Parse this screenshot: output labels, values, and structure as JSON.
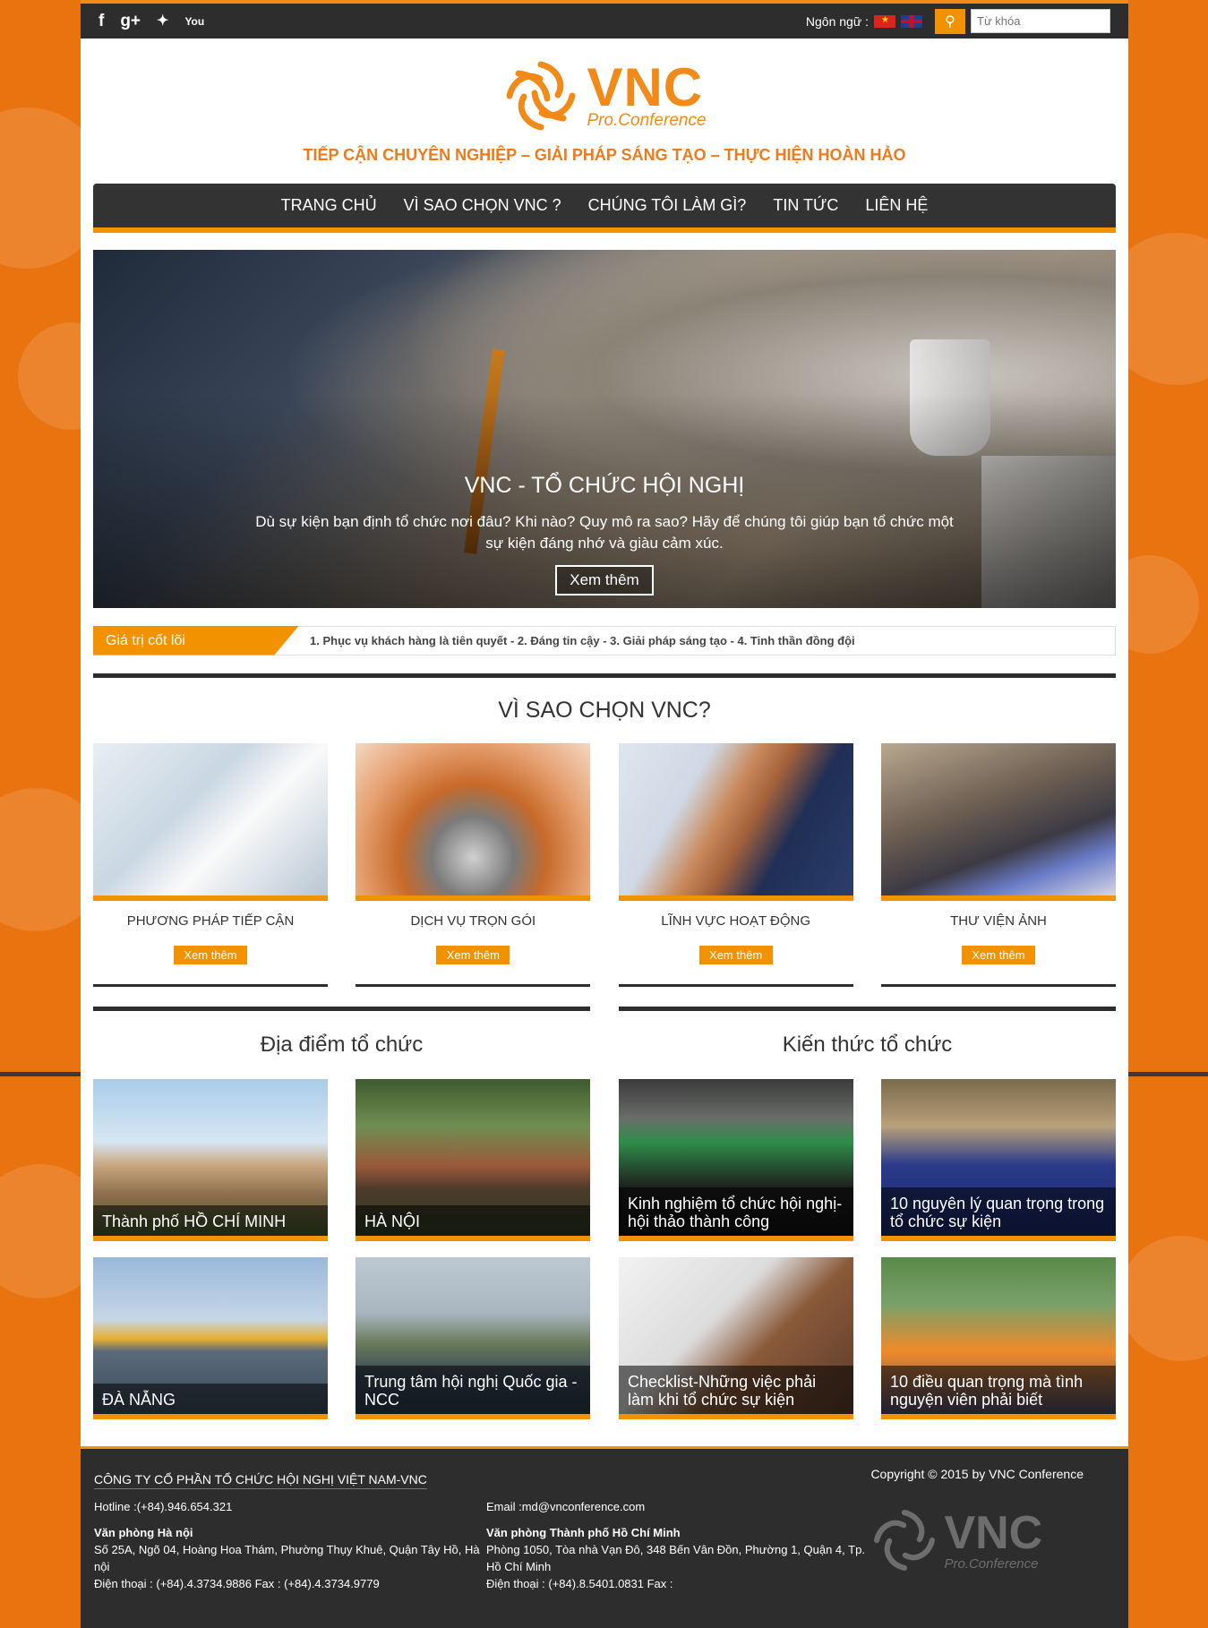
{
  "topbar": {
    "social": [
      {
        "name": "facebook-icon",
        "glyph": "f"
      },
      {
        "name": "google-plus-icon",
        "glyph": "g+"
      },
      {
        "name": "twitter-icon",
        "glyph": "🐦"
      },
      {
        "name": "youtube-icon",
        "glyph": "You"
      }
    ],
    "language_label": "Ngôn ngữ :",
    "search_placeholder": "Từ khóa"
  },
  "logo": {
    "main": "VNC",
    "sub": "Pro.Conference"
  },
  "tagline": "TIẾP CẬN CHUYÊN NGHIỆP – GIẢI PHÁP SÁNG TẠO – THỰC HIỆN HOÀN HẢO",
  "nav": [
    "TRANG CHỦ",
    "VÌ SAO CHỌN VNC ?",
    "CHÚNG TÔI LÀM GÌ?",
    "TIN TỨC",
    "LIÊN HỆ"
  ],
  "hero": {
    "title": "VNC - TỔ CHỨC HỘI NGHỊ",
    "description": "Dù sự kiện bạn định tổ chức nơi đâu? Khi nào? Quy mô ra sao? Hãy để chúng tôi giúp bạn tổ chức một sự kiện đáng nhớ và giàu cảm xúc.",
    "button": "Xem thêm"
  },
  "ticker": {
    "label": "Giá trị cốt lõi",
    "text": "1. Phục vụ khách hàng là tiên quyết - 2. Đáng tin cậy - 3. Giải pháp sáng tạo - 4. Tinh thần đồng đội"
  },
  "why": {
    "title": "VÌ SAO CHỌN VNC?",
    "cards": [
      {
        "title": "PHƯƠNG PHÁP TIẾP CẬN",
        "button": "Xem thêm"
      },
      {
        "title": "DỊCH VỤ TRỌN GÓI",
        "button": "Xem thêm"
      },
      {
        "title": "LĨNH VỰC HOẠT ĐỘNG",
        "button": "Xem thêm"
      },
      {
        "title": "THƯ VIỆN ẢNH",
        "button": "Xem thêm"
      }
    ]
  },
  "venues": {
    "title": "Địa điểm tổ chức",
    "items": [
      "Thành phố HỒ CHÍ MINH",
      "HÀ NỘI",
      "ĐÀ NẴNG",
      "Trung tâm hội nghị Quốc gia - NCC"
    ]
  },
  "knowledge": {
    "title": "Kiến thức tổ chức",
    "items": [
      "Kinh nghiệm tổ chức hội nghị-hội thảo thành công",
      "10 nguyên lý quan trọng trong tổ chức sự kiện",
      "Checklist-Những việc phải làm khi tổ chức sự kiện",
      "10 điều quan trọng mà tình nguyện viên phải biết"
    ]
  },
  "footer": {
    "company": "CÔNG TY CỔ PHẦN TỔ CHỨC HỘI NGHỊ VIỆT NAM-VNC",
    "hotline": "Hotline :(+84).946.654.321",
    "email": "Email :md@vnconference.com",
    "hn_title": "Văn phòng Hà nội",
    "hn_address": "Số 25A, Ngõ 04, Hoàng Hoa Thám, Phường Thụy Khuê, Quận Tây Hồ, Hà nội",
    "hn_phone": "Điện thoại : (+84).4.3734.9886   Fax : (+84).4.3734.9779",
    "hcm_title": "Văn phòng Thành phố Hồ Chí Minh",
    "hcm_address": "Phòng 1050, Tòa nhà Vạn Đô, 348 Bến Vân Đồn, Phường 1, Quận 4, Tp. Hồ Chí Minh",
    "hcm_phone": "Điện thoại : (+84).8.5401.0831   Fax :",
    "copyright": "Copyright © 2015 by VNC Conference"
  },
  "colors": {
    "accent": "#f39200",
    "dark": "#2d2d2d",
    "background": "#e9730f"
  }
}
